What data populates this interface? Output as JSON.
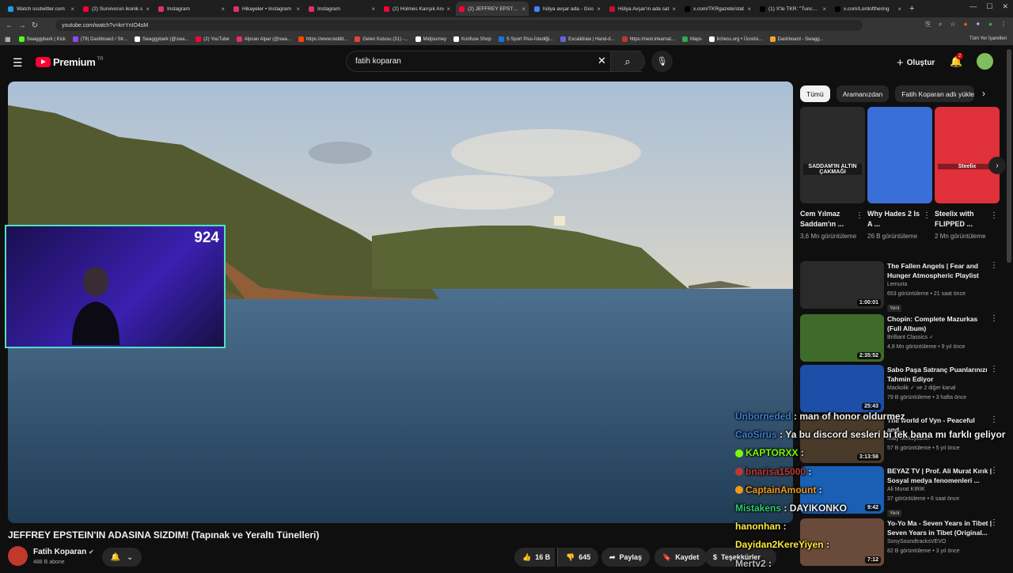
{
  "browser": {
    "tabs": [
      {
        "title": "Watch ssstwitter.com",
        "color": "#1d9bf0",
        "active": false
      },
      {
        "title": "(2) Survivorun ikonik s",
        "color": "#ff0033",
        "active": false
      },
      {
        "title": "Instagram",
        "color": "#e1306c",
        "active": false
      },
      {
        "title": "Hikayeler • Instagram",
        "color": "#e1306c",
        "active": false
      },
      {
        "title": "Instagram",
        "color": "#e1306c",
        "active": false
      },
      {
        "title": "(2) Holmes Karışık Anı",
        "color": "#ff0033",
        "active": false
      },
      {
        "title": "(2) JEFFREY EPSTEIN'IN",
        "color": "#ff0033",
        "active": true
      },
      {
        "title": "hülya avşar ada - Goo",
        "color": "#4285f4",
        "active": false
      },
      {
        "title": "Hülya Avşar'ın ada sat",
        "color": "#c8102e",
        "active": false
      },
      {
        "title": "x.com/TKRgazete/stat",
        "color": "#000000",
        "active": false
      },
      {
        "title": "(1) X'te TKR: \"Tuncer E",
        "color": "#000000",
        "active": false
      },
      {
        "title": "x.com/Lordofthering",
        "color": "#000000",
        "active": false
      }
    ],
    "new_tab": "+",
    "url": "youtube.com/watch?v=krrYnIO4sM",
    "bookmarks": [
      {
        "label": "Swaggybark | Kick",
        "color": "#53fc18"
      },
      {
        "label": "(79) Dashboard / Str...",
        "color": "#9147ff"
      },
      {
        "label": "Swaggybark (@swa...",
        "color": "#ffffff"
      },
      {
        "label": "(2) YouTube",
        "color": "#ff0033"
      },
      {
        "label": "Alpcan Alpar (@swa...",
        "color": "#e1306c"
      },
      {
        "label": "https://www.reddit...",
        "color": "#ff4500"
      },
      {
        "label": "Gelen Kutusu (31) -...",
        "color": "#ea4335"
      },
      {
        "label": "Midjourney",
        "color": "#ffffff"
      },
      {
        "label": "Konfuse Shop",
        "color": "#ffffff"
      },
      {
        "label": "S Sport Plus-İstediği...",
        "color": "#1a73e8"
      },
      {
        "label": "Excalidraw | Hand-d...",
        "color": "#6965db"
      },
      {
        "label": "https://next.inkarnat...",
        "color": "#c0392b"
      },
      {
        "label": "Maps",
        "color": "#34a853"
      },
      {
        "label": "lichess.org • Ücretsi...",
        "color": "#ffffff"
      },
      {
        "label": "Dashboard - Swagg...",
        "color": "#f5a623"
      }
    ],
    "all_bookmarks": "Tüm Yer İşaretleri"
  },
  "youtube": {
    "logo_text": "Premium",
    "country": "TR",
    "search_value": "fatih koparan",
    "create_label": "Oluştur",
    "notif_count": "2"
  },
  "video": {
    "title": "JEFFREY EPSTEIN'IN ADASINA SIZDIM! (Tapınak ve Yeraltı Tünelleri)",
    "channel": "Fatih Koparan",
    "subs": "488 B abone",
    "likes": "16 B",
    "dislikes": "645",
    "share": "Paylaş",
    "save": "Kaydet",
    "more": "Teşekkürler",
    "viewer_count": "924"
  },
  "chips": [
    "Tümü",
    "Aramanızdan",
    "Fatih Koparan adlı yükleyici"
  ],
  "shorts": [
    {
      "title": "Cem Yılmaz Saddam'ın ...",
      "views": "3,6 Mn görüntüleme",
      "caption": "SADDAM'IN ALTIN ÇAKMAĞI",
      "bg": "#2b2b2b"
    },
    {
      "title": "Why Hades 2 Is A ...",
      "views": "26 B görüntüleme",
      "caption": "",
      "bg": "#3a6fd8"
    },
    {
      "title": "Steelix with FLIPPED ...",
      "views": "2 Mn görüntüleme",
      "caption": "Steelix",
      "bg": "#e0303a"
    }
  ],
  "recommendations": [
    {
      "title": "The Fallen Angels | Fear and Hunger Atmospheric Playlist",
      "channel": "Lemuria",
      "meta": "653 görüntüleme • 21 saat önce",
      "badge": "Yeni",
      "duration": "1:00:01",
      "bg": "#2a2a2a"
    },
    {
      "title": "Chopin: Complete Mazurkas (Full Album)",
      "channel": "Brilliant Classics ✓",
      "meta": "4,8 Mn görüntüleme • 9 yıl önce",
      "badge": "",
      "duration": "2:35:52",
      "bg": "#3f6b2a"
    },
    {
      "title": "Sabo Paşa Satranç Puanlarınızı Tahmin Ediyor",
      "channel": "Mackolik ✓ ve 2 diğer kanal",
      "meta": "79 B görüntüleme • 3 hafta önce",
      "badge": "",
      "duration": "25:43",
      "bg": "#1d4ea8"
    },
    {
      "title": "The world of Vyn - Peaceful and...",
      "channel": "Maly Meksykanin",
      "meta": "57 B görüntüleme • 5 yıl önce",
      "badge": "",
      "duration": "3:13:58",
      "bg": "#4a3a2a"
    },
    {
      "title": "BEYAZ TV | Prof. Ali Murat Kırık | Sosyal medya fenomenleri ...",
      "channel": "Ali Murat KIRIK",
      "meta": "37 görüntüleme • 6 saat önce",
      "badge": "Yeni",
      "duration": "9:42",
      "bg": "#1a5fb4"
    },
    {
      "title": "Yo-Yo Ma - Seven Years in Tibet | Seven Years in Tibet (Original...",
      "channel": "SonySoundtracksVEVO",
      "meta": "82 B görüntüleme • 3 yıl önce",
      "badge": "",
      "duration": "7:12",
      "bg": "#6a4a3a"
    }
  ],
  "chat": [
    {
      "user": "Unborneded",
      "msg": "man of honor oldurmez",
      "color": "#3a7fd5"
    },
    {
      "user": "CaoSirus",
      "msg": "Ya bu discord sesleri bi tek bana mı farklı geliyor",
      "color": "#3a7fd5"
    },
    {
      "user": "KAPTORXX",
      "msg": "",
      "color": "#7cfc00"
    },
    {
      "user": "bnarisa15000",
      "msg": "",
      "color": "#c0392b"
    },
    {
      "user": "CaptainAmount",
      "msg": "",
      "color": "#f39c12"
    },
    {
      "user": "Mistakens",
      "msg": "DAYIKONKO",
      "color": "#2ecc71"
    },
    {
      "user": "hanonhan",
      "msg": "",
      "color": "#ffeb3b"
    },
    {
      "user": "Dayidan2KereYiyen",
      "msg": "",
      "color": "#ffeb3b"
    },
    {
      "user": "Mertv2",
      "msg": "",
      "color": "#bbbbbb"
    }
  ]
}
